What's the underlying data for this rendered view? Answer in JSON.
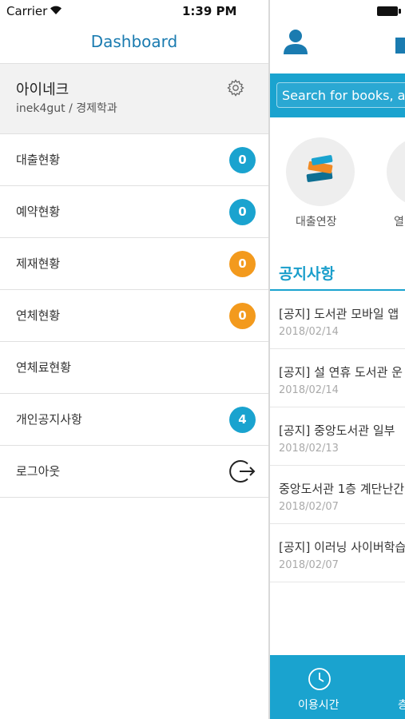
{
  "status_bar": {
    "carrier": "Carrier",
    "time": "1:39 PM"
  },
  "sidebar": {
    "title": "Dashboard",
    "profile": {
      "name": "아이네크",
      "subtitle": "inek4gut / 경제학과"
    },
    "items": [
      {
        "label": "대출현황",
        "badge": "0",
        "badge_color": "#1aa3cf"
      },
      {
        "label": "예약현황",
        "badge": "0",
        "badge_color": "#1aa3cf"
      },
      {
        "label": "제재현황",
        "badge": "0",
        "badge_color": "#f39a1d"
      },
      {
        "label": "연체현황",
        "badge": "0",
        "badge_color": "#f39a1d"
      },
      {
        "label": "연체료현황"
      },
      {
        "label": "개인공지사항",
        "badge": "4",
        "badge_color": "#1aa3cf"
      },
      {
        "label": "로그아웃",
        "icon": "logout-icon"
      }
    ]
  },
  "main": {
    "search": {
      "placeholder": "Search for books, a"
    },
    "quick_links": [
      {
        "label": "대출연장",
        "icon": "books-icon"
      },
      {
        "label": "열"
      }
    ],
    "notices_title": "공지사항",
    "notices": [
      {
        "title": "[공지] 도서관 모바일 앱",
        "date": "2018/02/14"
      },
      {
        "title": "[공지] 설 연휴 도서관 운",
        "date": "2018/02/14"
      },
      {
        "title": "[공지] 중앙도서관 일부",
        "date": "2018/02/13"
      },
      {
        "title": "중앙도서관 1층 계단난간",
        "date": "2018/02/07"
      },
      {
        "title": "[공지] 이러닝 사이버학습",
        "date": "2018/02/07"
      }
    ],
    "bottom_nav": [
      {
        "label": "이용시간",
        "icon": "clock-icon"
      },
      {
        "label": "층"
      }
    ]
  },
  "colors": {
    "accent": "#1aa3cf",
    "warning": "#f39a1d",
    "title": "#1a7bb0"
  }
}
